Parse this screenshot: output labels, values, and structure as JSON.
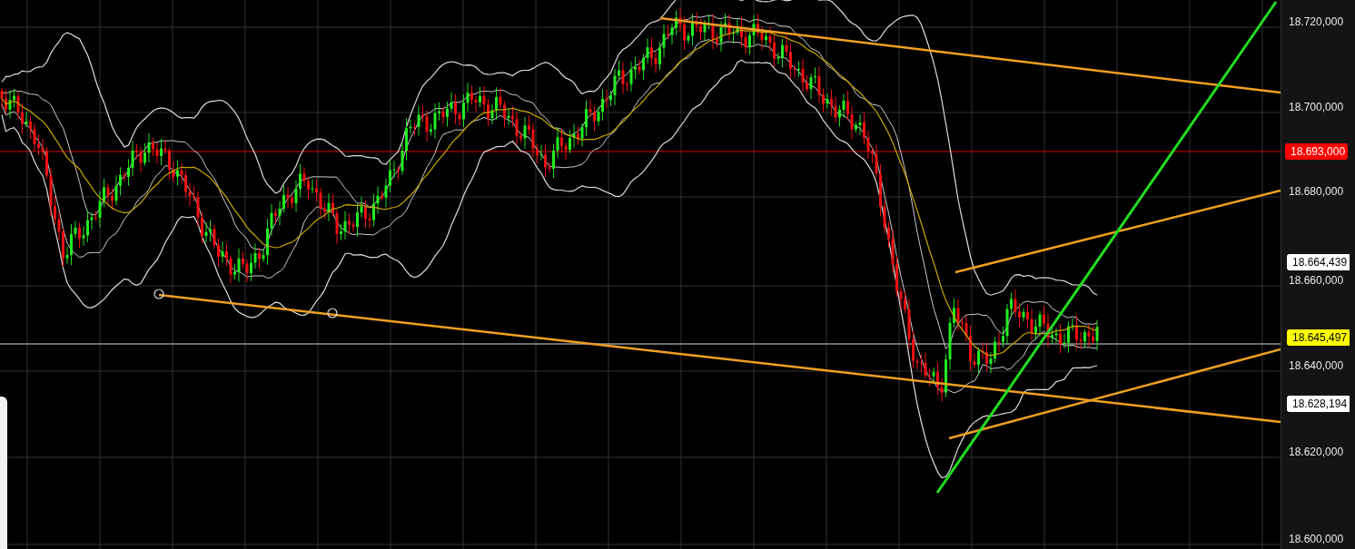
{
  "price_axis": {
    "ticks": [
      "18.720,000",
      "18.700,000",
      "18.680,000",
      "18.660,000",
      "18.640,000",
      "18.620,000",
      "18.600,000"
    ],
    "markers": [
      {
        "label": "18.693,000",
        "color": "#ff0000"
      },
      {
        "label": "18.664,439",
        "color": "#ffffff"
      },
      {
        "label": "18.645,497",
        "color": "#ffff00"
      },
      {
        "label": "18.628,194",
        "color": "#ffffff"
      }
    ]
  }
}
